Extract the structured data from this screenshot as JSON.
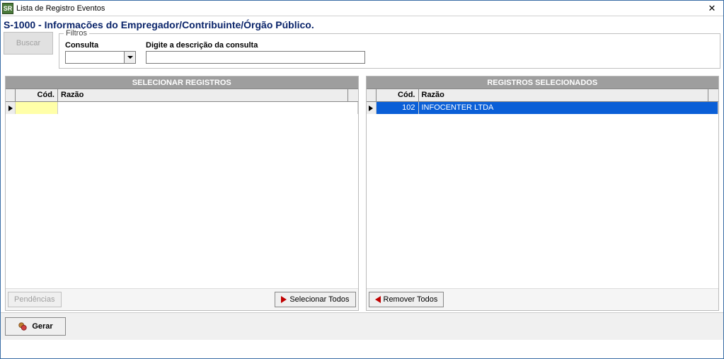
{
  "window": {
    "icon_text": "SR",
    "title": "Lista de Registro Eventos",
    "close_label": "✕"
  },
  "header": {
    "title": "S-1000 - Informações do Empregador/Contribuinte/Órgão Público."
  },
  "buttons": {
    "buscar": "Buscar",
    "pendencias": "Pendências",
    "selecionar_todos": "Selecionar Todos",
    "remover_todos": "Remover Todos",
    "gerar": "Gerar"
  },
  "filtros": {
    "legend": "Filtros",
    "consulta_label": "Consulta",
    "consulta_value": "",
    "descricao_label": "Digite a descrição da consulta",
    "descricao_value": ""
  },
  "panels": {
    "left_title": "SELECIONAR REGISTROS",
    "right_title": "REGISTROS SELECIONADOS",
    "col_cod": "Cód.",
    "col_razao": "Razão"
  },
  "left_rows": [
    {
      "cod": "",
      "razao": ""
    }
  ],
  "right_rows": [
    {
      "cod": "102",
      "razao": "INFOCENTER LTDA"
    }
  ]
}
